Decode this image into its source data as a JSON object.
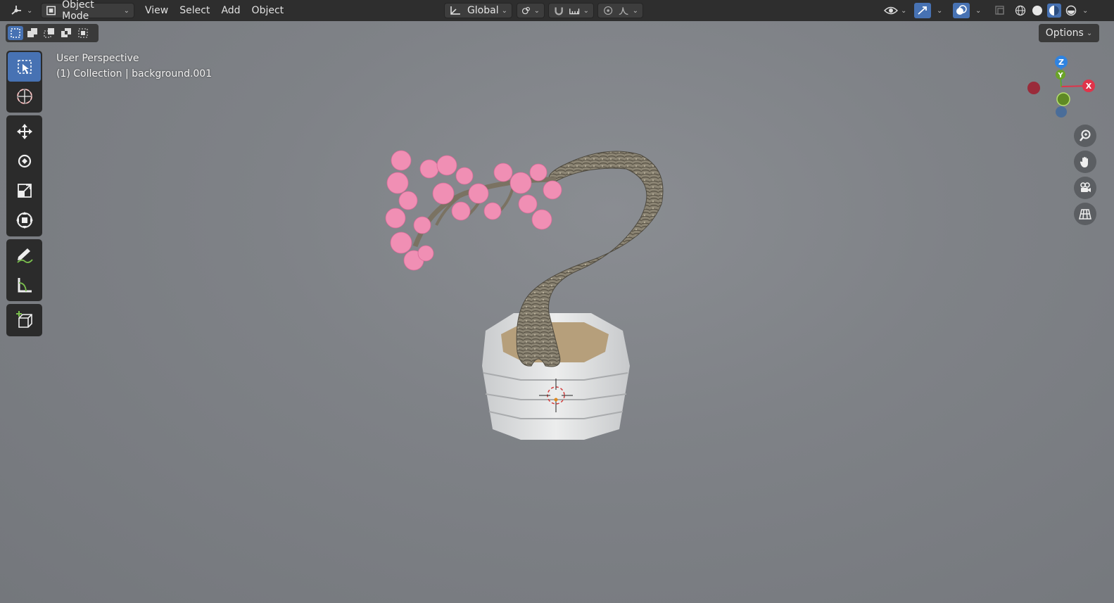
{
  "header": {
    "editor_type_icon": "3d-viewport-icon",
    "mode": {
      "label": "Object Mode",
      "icon": "object-mode-icon"
    },
    "menus": [
      "View",
      "Select",
      "Add",
      "Object"
    ],
    "transform_orientation": {
      "label": "Global",
      "icon": "transform-orientation-icon"
    },
    "pivot_icon": "pivot-point-icon",
    "snap_icon": "snap-magnet-icon",
    "snap_target_icon": "snap-increment-icon",
    "proportional_icon": "proportional-editing-icon",
    "falloff_icon": "falloff-curve-icon",
    "visibility_icon": "eye-icon",
    "gizmo_toggle_icon": "gizmo-icon",
    "overlay_toggle_icon": "overlays-icon",
    "xray_icon": "xray-icon",
    "shading_modes": [
      "wireframe",
      "solid",
      "material-preview",
      "rendered"
    ],
    "active_shading": "material-preview"
  },
  "subheader": {
    "selection_modes": [
      "set",
      "extend",
      "subtract",
      "difference",
      "intersect"
    ],
    "active_selection_mode": 0,
    "options_label": "Options"
  },
  "toolbar": {
    "tools": [
      {
        "name": "select-box",
        "icon": "select-box-icon",
        "active": true
      },
      {
        "name": "cursor",
        "icon": "cursor-icon"
      },
      {
        "name": "move",
        "icon": "move-icon"
      },
      {
        "name": "rotate",
        "icon": "rotate-icon"
      },
      {
        "name": "scale",
        "icon": "scale-icon"
      },
      {
        "name": "transform",
        "icon": "transform-icon"
      },
      {
        "name": "annotate",
        "icon": "annotate-icon"
      },
      {
        "name": "measure",
        "icon": "measure-icon"
      },
      {
        "name": "add-cube",
        "icon": "add-cube-icon"
      }
    ]
  },
  "viewport": {
    "perspective_label": "User Perspective",
    "collection_label": "(1) Collection | background.001"
  },
  "gizmo": {
    "x_label": "X",
    "y_label": "Y",
    "z_label": "Z"
  },
  "nav_buttons": [
    "zoom-icon",
    "pan-hand-icon",
    "camera-view-icon",
    "ortho-grid-icon"
  ],
  "colors": {
    "header_bg": "#2e2e2e",
    "accent": "#4772b3",
    "axis_x": "#e0344a",
    "axis_y": "#6aa328",
    "axis_z": "#2f83e0",
    "viewport_bg": "#7d8085"
  }
}
